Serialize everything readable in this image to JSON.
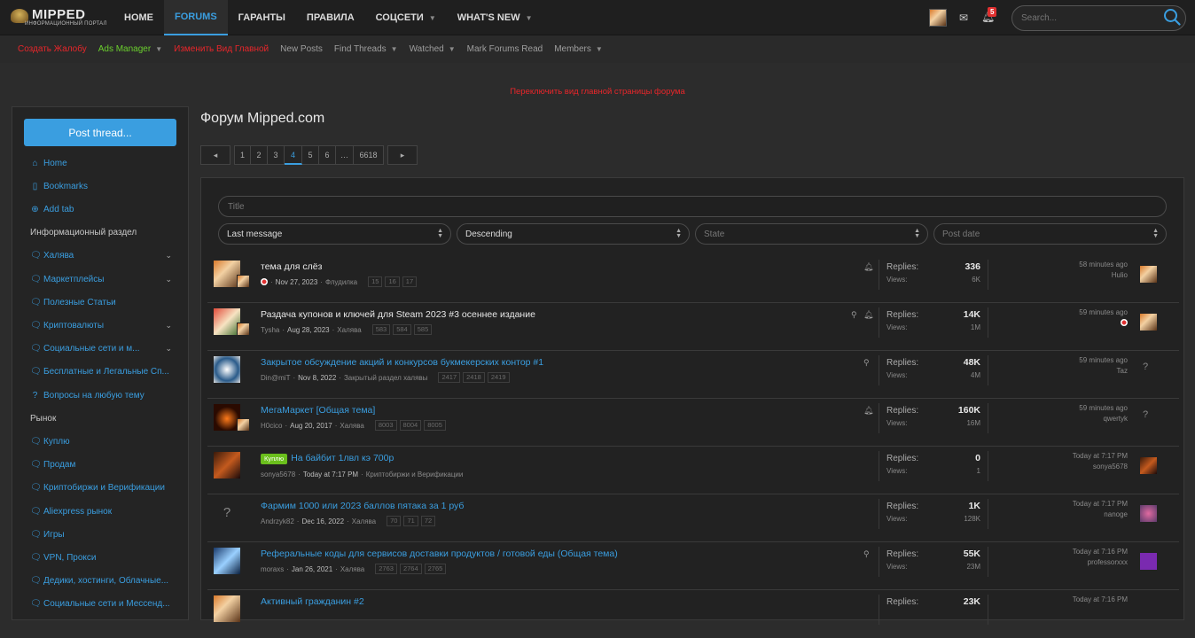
{
  "brand": {
    "name": "MIPPED",
    "tagline": "ИНФОРМАЦИОННЫЙ ПОРТАЛ"
  },
  "nav": [
    {
      "label": "HOME"
    },
    {
      "label": "FORUMS"
    },
    {
      "label": "ГАРАНТЫ"
    },
    {
      "label": "ПРАВИЛА"
    },
    {
      "label": "СОЦСЕТИ"
    },
    {
      "label": "WHAT'S NEW"
    }
  ],
  "notifications_count": "5",
  "search": {
    "placeholder": "Search..."
  },
  "subnav": [
    {
      "label": "Создать Жалобу",
      "color": "#e8262a"
    },
    {
      "label": "Ads Manager",
      "color": "#6bcf2e"
    },
    {
      "label": "Изменить Вид Главной",
      "color": "#e8262a"
    },
    {
      "label": "New Posts",
      "color": "#9e9e9e"
    },
    {
      "label": "Find Threads",
      "color": "#9e9e9e"
    },
    {
      "label": "Watched",
      "color": "#9e9e9e"
    },
    {
      "label": "Mark Forums Read",
      "color": "#9e9e9e"
    },
    {
      "label": "Members",
      "color": "#9e9e9e"
    }
  ],
  "notice": "Переключить вид главной страницы форума",
  "sidebar": {
    "post_thread": "Post thread...",
    "items": [
      {
        "label": "Home",
        "icon": "home-icon"
      },
      {
        "label": "Bookmarks",
        "icon": "bookmark-icon"
      },
      {
        "label": "Add tab",
        "icon": "plus-circle-icon"
      },
      {
        "label": "Информационный раздел",
        "heading": true
      },
      {
        "label": "Халява",
        "icon": "chat-icon"
      },
      {
        "label": "Маркетплейсы",
        "icon": "chat-icon"
      },
      {
        "label": "Полезные Статьи",
        "icon": "chat-icon"
      },
      {
        "label": "Криптовалюты",
        "icon": "chat-icon"
      },
      {
        "label": "Социальные сети и м...",
        "icon": "chat-icon"
      },
      {
        "label": "Бесплатные и Легальные Сп...",
        "icon": "chat-icon"
      },
      {
        "label": "Вопросы на любую тему",
        "icon": "question-circle-icon"
      },
      {
        "label": "Рынок",
        "heading": true
      },
      {
        "label": "Куплю",
        "icon": "chat-icon"
      },
      {
        "label": "Продам",
        "icon": "chat-icon"
      },
      {
        "label": "Криптобиржи и Верификации",
        "icon": "chat-icon"
      },
      {
        "label": "Aliexpress рынок",
        "icon": "chat-icon"
      },
      {
        "label": "Игры",
        "icon": "chat-icon"
      },
      {
        "label": "VPN, Прокси",
        "icon": "chat-icon"
      },
      {
        "label": "Дедики, хостинги, Облачные...",
        "icon": "chat-icon"
      },
      {
        "label": "Социальные сети и Мессенд...",
        "icon": "chat-icon"
      }
    ]
  },
  "page_title": "Форум Mipped.com",
  "pagination": {
    "pages": [
      "1",
      "2",
      "3",
      "4",
      "5",
      "6",
      "…",
      "6618"
    ],
    "current": "4"
  },
  "filters": {
    "title_placeholder": "Title",
    "sort": "Last message",
    "order": "Descending",
    "state": "State",
    "post_date": "Post date"
  },
  "threads": [
    {
      "title": "тема для слёз",
      "author": "",
      "date": "Nov 27, 2023",
      "forum": "Флудилка",
      "pages": [
        "15",
        "16",
        "17"
      ],
      "replies": "336",
      "views": "6K",
      "last_time": "58 minutes ago",
      "last_user": "Hulio",
      "bell": true,
      "pin": false
    },
    {
      "title": "Раздача купонов и ключей для Steam 2023 #3 осеннее издание",
      "author": "Tysha",
      "date": "Aug 28, 2023",
      "forum": "Халява",
      "pages": [
        "583",
        "584",
        "585"
      ],
      "replies": "14K",
      "views": "1M",
      "last_time": "59 minutes ago",
      "last_user": "",
      "bell": true,
      "pin": true
    },
    {
      "title": "Закрытое обсуждение акций и конкурсов букмекерских контор #1",
      "author": "Din@miT",
      "date": "Nov 8, 2022",
      "forum": "Закрытый раздел халявы",
      "pages": [
        "2417",
        "2418",
        "2419"
      ],
      "replies": "48K",
      "views": "4M",
      "last_time": "59 minutes ago",
      "last_user": "Taz",
      "bell": false,
      "pin": true
    },
    {
      "title": "МегаМаркет [Общая тема]",
      "author": "H0cico",
      "date": "Aug 20, 2017",
      "forum": "Халява",
      "pages": [
        "8003",
        "8004",
        "8005"
      ],
      "replies": "160K",
      "views": "16M",
      "last_time": "59 minutes ago",
      "last_user": "qwertyk",
      "bell": true,
      "pin": false
    },
    {
      "title": "На байбит 1лвл кэ 700р",
      "prefix": "Куплю",
      "author": "sonya5678",
      "date": "Today at 7:17 PM",
      "forum": "Криптобиржи и Верификации",
      "pages": [],
      "replies": "0",
      "views": "1",
      "last_time": "Today at 7:17 PM",
      "last_user": "sonya5678",
      "bell": false,
      "pin": false
    },
    {
      "title": "Фармим 1000 или 2023 баллов пятака за 1 руб",
      "author": "Andrzyk82",
      "date": "Dec 16, 2022",
      "forum": "Халява",
      "pages": [
        "70",
        "71",
        "72"
      ],
      "replies": "1K",
      "views": "128K",
      "last_time": "Today at 7:17 PM",
      "last_user": "nanoge",
      "bell": false,
      "pin": false
    },
    {
      "title": "Реферальные коды для сервисов доставки продуктов / готовой еды (Общая тема)",
      "author": "moraxs",
      "date": "Jan 26, 2021",
      "forum": "Халява",
      "pages": [
        "2763",
        "2764",
        "2765"
      ],
      "replies": "55K",
      "views": "23M",
      "last_time": "Today at 7:16 PM",
      "last_user": "professorxxx",
      "bell": false,
      "pin": true
    },
    {
      "title": "Активный гражданин #2",
      "author": "",
      "date": "",
      "forum": "",
      "pages": [],
      "replies": "23K",
      "views": "",
      "last_time": "Today at 7:16 PM",
      "last_user": "",
      "bell": false,
      "pin": false
    }
  ],
  "labels": {
    "replies": "Replies:",
    "views": "Views:"
  },
  "colors": {
    "accent": "#3a9ee0",
    "alert": "#e8262a",
    "green": "#6bcf2e"
  }
}
